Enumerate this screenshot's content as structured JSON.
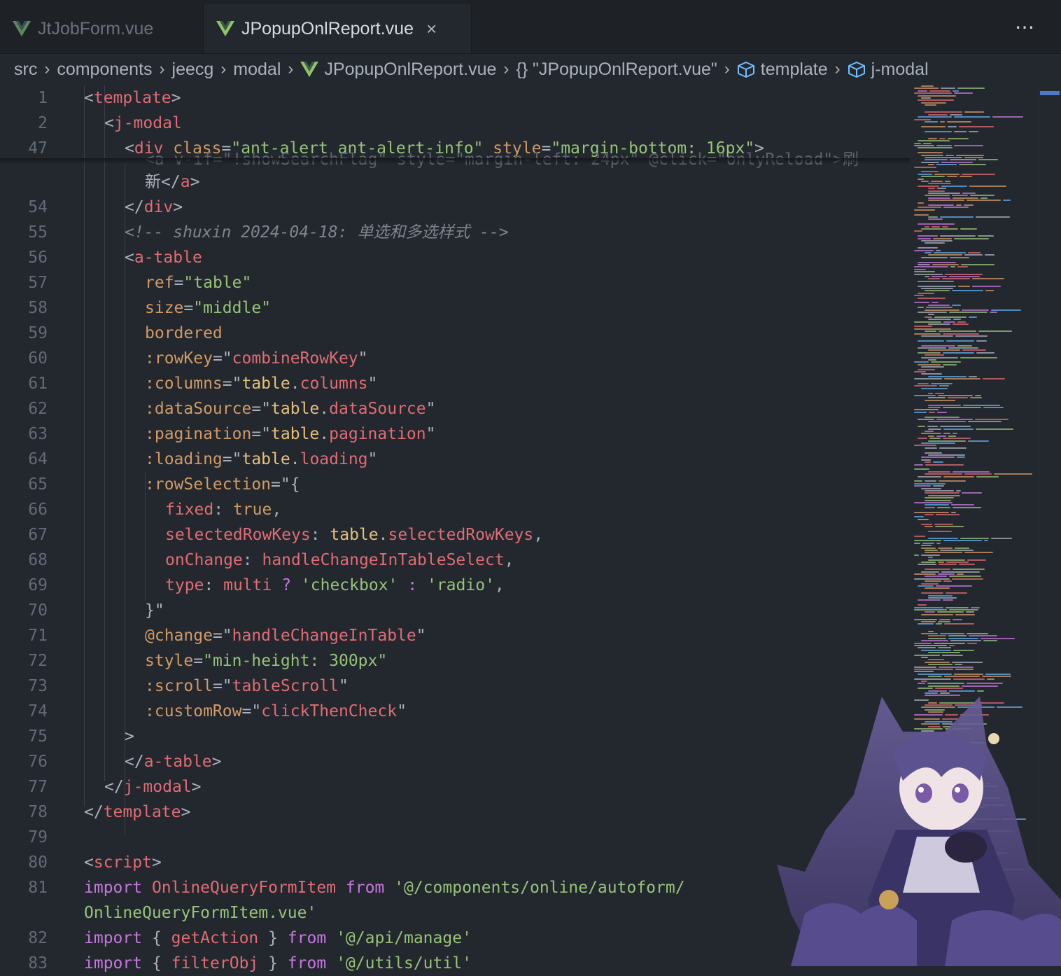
{
  "tabs": [
    {
      "label": "JtJobForm.vue",
      "active": false
    },
    {
      "label": "JPopupOnlReport.vue",
      "active": true,
      "close": "×"
    }
  ],
  "more_icon": "⋯",
  "breadcrumb": [
    "src",
    "components",
    "jeecg",
    "modal",
    "JPopupOnlReport.vue",
    "{} \"JPopupOnlReport.vue\"",
    "template",
    "j-modal"
  ],
  "colors": {
    "background": "#23272e",
    "tag": "#e06c75",
    "attribute": "#d19a66",
    "string": "#98c379",
    "keyword": "#c678dd",
    "function": "#61afef",
    "comment": "#7f848e",
    "line_number": "#636b78",
    "accent": "#4d78cc"
  },
  "sticky_lines": [
    {
      "ln": "1",
      "indent": 0,
      "tokens": [
        [
          "p",
          "<"
        ],
        [
          "t",
          "template"
        ],
        [
          "p",
          ">"
        ]
      ]
    },
    {
      "ln": "2",
      "indent": 1,
      "tokens": [
        [
          "p",
          "<"
        ],
        [
          "t",
          "j-modal"
        ]
      ]
    },
    {
      "ln": "47",
      "indent": 2,
      "tokens": [
        [
          "p",
          "<"
        ],
        [
          "t",
          "div "
        ],
        [
          "a",
          "class"
        ],
        [
          "p",
          "="
        ],
        [
          "s",
          "\"ant-alert ant-alert-info\" "
        ],
        [
          "a",
          "style"
        ],
        [
          "p",
          "="
        ],
        [
          "s",
          "\"margin-bottom: 16px\""
        ],
        [
          "p",
          ">"
        ]
      ]
    }
  ],
  "lines": [
    {
      "ln": "",
      "indent": 3,
      "tokens": [
        [
          "p",
          "新</"
        ],
        [
          "t",
          "a"
        ],
        [
          "p",
          ">"
        ]
      ]
    },
    {
      "ln": "54",
      "indent": 2,
      "tokens": [
        [
          "p",
          "</"
        ],
        [
          "t",
          "div"
        ],
        [
          "p",
          ">"
        ]
      ]
    },
    {
      "ln": "55",
      "indent": 2,
      "tokens": [
        [
          "c",
          "<!-- shuxin 2024-04-18: 单选和多选样式 -->"
        ]
      ]
    },
    {
      "ln": "56",
      "indent": 2,
      "tokens": [
        [
          "p",
          "<"
        ],
        [
          "t",
          "a-table"
        ]
      ]
    },
    {
      "ln": "57",
      "indent": 3,
      "tokens": [
        [
          "a",
          "ref"
        ],
        [
          "p",
          "="
        ],
        [
          "s",
          "\"table\""
        ]
      ]
    },
    {
      "ln": "58",
      "indent": 3,
      "tokens": [
        [
          "a",
          "size"
        ],
        [
          "p",
          "="
        ],
        [
          "s",
          "\"middle\""
        ]
      ]
    },
    {
      "ln": "59",
      "indent": 3,
      "tokens": [
        [
          "a",
          "bordered"
        ]
      ]
    },
    {
      "ln": "60",
      "indent": 3,
      "tokens": [
        [
          "a",
          ":rowKey"
        ],
        [
          "p",
          "=\""
        ],
        [
          "t",
          "combineRowKey"
        ],
        [
          "p",
          "\""
        ]
      ]
    },
    {
      "ln": "61",
      "indent": 3,
      "tokens": [
        [
          "a",
          ":columns"
        ],
        [
          "p",
          "=\""
        ],
        [
          "v",
          "table"
        ],
        [
          "p",
          "."
        ],
        [
          "t",
          "columns"
        ],
        [
          "p",
          "\""
        ]
      ]
    },
    {
      "ln": "62",
      "indent": 3,
      "tokens": [
        [
          "a",
          ":dataSource"
        ],
        [
          "p",
          "=\""
        ],
        [
          "v",
          "table"
        ],
        [
          "p",
          "."
        ],
        [
          "t",
          "dataSource"
        ],
        [
          "p",
          "\""
        ]
      ]
    },
    {
      "ln": "63",
      "indent": 3,
      "tokens": [
        [
          "a",
          ":pagination"
        ],
        [
          "p",
          "=\""
        ],
        [
          "v",
          "table"
        ],
        [
          "p",
          "."
        ],
        [
          "t",
          "pagination"
        ],
        [
          "p",
          "\""
        ]
      ]
    },
    {
      "ln": "64",
      "indent": 3,
      "tokens": [
        [
          "a",
          ":loading"
        ],
        [
          "p",
          "=\""
        ],
        [
          "v",
          "table"
        ],
        [
          "p",
          "."
        ],
        [
          "t",
          "loading"
        ],
        [
          "p",
          "\""
        ]
      ]
    },
    {
      "ln": "65",
      "indent": 3,
      "tokens": [
        [
          "a",
          ":rowSelection"
        ],
        [
          "p",
          "=\"{"
        ]
      ]
    },
    {
      "ln": "66",
      "indent": 4,
      "tokens": [
        [
          "t",
          "fixed"
        ],
        [
          "p",
          ": "
        ],
        [
          "a",
          "true"
        ],
        [
          "p",
          ","
        ]
      ]
    },
    {
      "ln": "67",
      "indent": 4,
      "tokens": [
        [
          "t",
          "selectedRowKeys"
        ],
        [
          "p",
          ": "
        ],
        [
          "v",
          "table"
        ],
        [
          "p",
          "."
        ],
        [
          "t",
          "selectedRowKeys"
        ],
        [
          "p",
          ","
        ]
      ]
    },
    {
      "ln": "68",
      "indent": 4,
      "tokens": [
        [
          "t",
          "onChange"
        ],
        [
          "p",
          ": "
        ],
        [
          "t",
          "handleChangeInTableSelect"
        ],
        [
          "p",
          ","
        ]
      ]
    },
    {
      "ln": "69",
      "indent": 4,
      "tokens": [
        [
          "t",
          "type"
        ],
        [
          "p",
          ": "
        ],
        [
          "t",
          "multi"
        ],
        [
          "p",
          " "
        ],
        [
          "k",
          "?"
        ],
        [
          "p",
          " "
        ],
        [
          "s",
          "'checkbox'"
        ],
        [
          "p",
          " "
        ],
        [
          "k",
          ":"
        ],
        [
          "p",
          " "
        ],
        [
          "s",
          "'radio'"
        ],
        [
          "p",
          ","
        ]
      ]
    },
    {
      "ln": "70",
      "indent": 3,
      "tokens": [
        [
          "p",
          "}\""
        ]
      ]
    },
    {
      "ln": "71",
      "indent": 3,
      "tokens": [
        [
          "a",
          "@change"
        ],
        [
          "p",
          "=\""
        ],
        [
          "t",
          "handleChangeInTable"
        ],
        [
          "p",
          "\""
        ]
      ]
    },
    {
      "ln": "72",
      "indent": 3,
      "tokens": [
        [
          "a",
          "style"
        ],
        [
          "p",
          "="
        ],
        [
          "s",
          "\"min-height: 300px\""
        ]
      ]
    },
    {
      "ln": "73",
      "indent": 3,
      "tokens": [
        [
          "a",
          ":scroll"
        ],
        [
          "p",
          "=\""
        ],
        [
          "t",
          "tableScroll"
        ],
        [
          "p",
          "\""
        ]
      ]
    },
    {
      "ln": "74",
      "indent": 3,
      "tokens": [
        [
          "a",
          ":customRow"
        ],
        [
          "p",
          "=\""
        ],
        [
          "t",
          "clickThenCheck"
        ],
        [
          "p",
          "\""
        ]
      ]
    },
    {
      "ln": "75",
      "indent": 2,
      "tokens": [
        [
          "p",
          ">"
        ]
      ]
    },
    {
      "ln": "76",
      "indent": 2,
      "tokens": [
        [
          "p",
          "</"
        ],
        [
          "t",
          "a-table"
        ],
        [
          "p",
          ">"
        ]
      ]
    },
    {
      "ln": "77",
      "indent": 1,
      "tokens": [
        [
          "p",
          "</"
        ],
        [
          "t",
          "j-modal"
        ],
        [
          "p",
          ">"
        ]
      ]
    },
    {
      "ln": "78",
      "indent": 0,
      "tokens": [
        [
          "p",
          "</"
        ],
        [
          "t",
          "template"
        ],
        [
          "p",
          ">"
        ]
      ]
    },
    {
      "ln": "79",
      "indent": 0,
      "tokens": []
    },
    {
      "ln": "80",
      "indent": 0,
      "tokens": [
        [
          "p",
          "<"
        ],
        [
          "t",
          "script"
        ],
        [
          "p",
          ">"
        ]
      ]
    },
    {
      "ln": "81",
      "indent": 0,
      "tokens": [
        [
          "k",
          "import "
        ],
        [
          "t",
          "OnlineQueryFormItem "
        ],
        [
          "k",
          "from "
        ],
        [
          "s",
          "'@/components/online/autoform/"
        ]
      ]
    },
    {
      "ln": "",
      "indent": 0,
      "tokens": [
        [
          "s",
          "OnlineQueryFormItem.vue'"
        ]
      ]
    },
    {
      "ln": "82",
      "indent": 0,
      "tokens": [
        [
          "k",
          "import "
        ],
        [
          "p",
          "{ "
        ],
        [
          "t",
          "getAction"
        ],
        [
          "p",
          " } "
        ],
        [
          "k",
          "from "
        ],
        [
          "s",
          "'@/api/manage'"
        ]
      ]
    },
    {
      "ln": "83",
      "indent": 0,
      "tokens": [
        [
          "k",
          "import "
        ],
        [
          "p",
          "{ "
        ],
        [
          "t",
          "filterObj"
        ],
        [
          "p",
          " } "
        ],
        [
          "k",
          "from "
        ],
        [
          "s",
          "'@/utils/util'"
        ]
      ]
    }
  ],
  "clipped_line": "<a v-if=\"!showSearchFlag\" style=\"margin-left: 24px\" @click=\"onlyReload\">刷"
}
